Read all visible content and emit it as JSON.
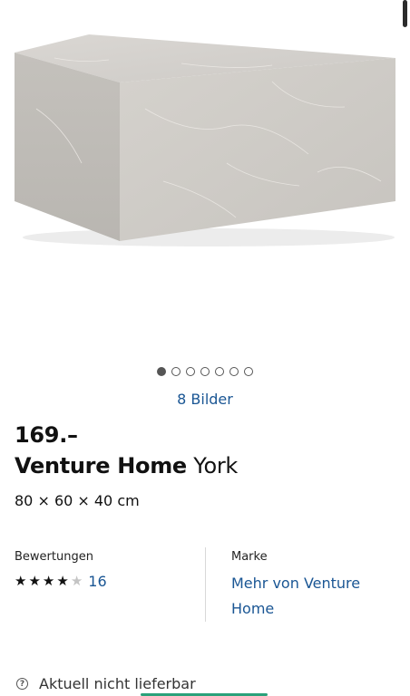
{
  "gallery": {
    "image_count_label": "8 Bilder",
    "dot_count": 7,
    "active_index": 0
  },
  "product": {
    "price": "169.–",
    "brand": "Venture Home",
    "model": "York",
    "dimensions": "80 × 60 × 40 cm"
  },
  "reviews": {
    "label": "Bewertungen",
    "rating": 4,
    "max_rating": 5,
    "count": "16"
  },
  "brand_section": {
    "label": "Marke",
    "link_text": "Mehr von Venture Home"
  },
  "availability": {
    "icon": "help-icon",
    "text": "Aktuell nicht lieferbar"
  },
  "colors": {
    "link": "#1a5694",
    "accent": "#2aa17a"
  }
}
